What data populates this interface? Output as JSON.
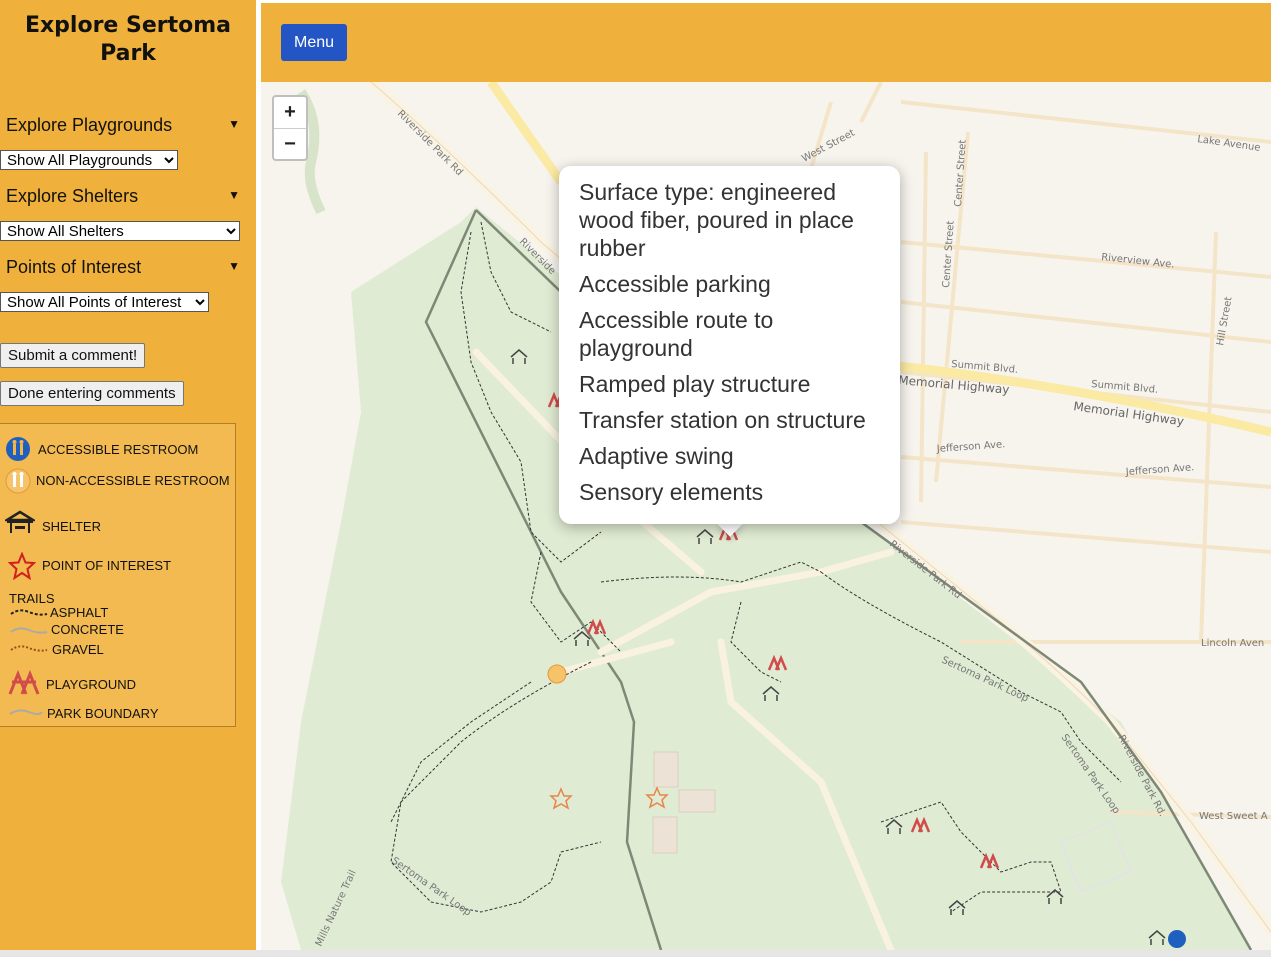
{
  "sidebar": {
    "title": "Explore Sertoma Park",
    "sections": [
      {
        "heading": "Explore Playgrounds",
        "select": "Show All Playgrounds"
      },
      {
        "heading": "Explore Shelters",
        "select": "Show All Shelters"
      },
      {
        "heading": "Points of Interest",
        "select": "Show All Points of Interest"
      }
    ],
    "submit_label": "Submit a comment!",
    "done_label": "Done entering comments"
  },
  "legend": {
    "accessible_restroom": "ACCESSIBLE RESTROOM",
    "nonaccessible_restroom": "NON-ACCESSIBLE RESTROOM",
    "shelter": "SHELTER",
    "point_of_interest": "POINT OF INTEREST",
    "trails": "TRAILS",
    "asphalt": "ASPHALT",
    "concrete": "CONCRETE",
    "gravel": "GRAVEL",
    "playground": "PLAYGROUND",
    "park_boundary": "PARK BOUNDARY"
  },
  "topbar": {
    "menu_label": "Menu"
  },
  "map": {
    "zoom_in": "+",
    "zoom_out": "−",
    "streets": {
      "riverside_park_rd_1": "Riverside Park Rd",
      "riverside_park_rd_2": "Riverside",
      "riverside_park_rd_3": "Riverside Park Rd",
      "riverside_park_rd_4": "Riverside Park Rd.",
      "west_street": "West Street",
      "lake_avenue": "Lake Avenue",
      "center_street_1": "Center Street",
      "center_street_2": "Center Street",
      "riverview_ave": "Riverview Ave.",
      "hill_street": "Hill Street",
      "summit_blvd_1": "Summit Blvd.",
      "summit_blvd_2": "Summit Blvd.",
      "memorial_highway_1": "Memorial Highway",
      "memorial_highway_2": "Memorial Highway",
      "jefferson_ave_1": "Jefferson Ave.",
      "jefferson_ave_2": "Jefferson Ave.",
      "lincoln_avenue": "Lincoln Aven",
      "west_sweet": "West Sweet A",
      "sertoma_park_loop_1": "Sertoma Park Loop",
      "sertoma_park_loop_2": "Sertoma Park Loop",
      "sertoma_park_loop_3": "Sertoma Park Loop",
      "mills_nature_trail": "Mills Nature Trail"
    },
    "popup": {
      "items": [
        "Surface type: engineered wood fiber, poured in place rubber",
        "Accessible parking",
        "Accessible route to playground",
        "Ramped play structure",
        "Transfer station on structure",
        "Adaptive swing",
        "Sensory elements"
      ]
    }
  },
  "colors": {
    "sidebar_bg": "#f0b13c",
    "menu_button": "#2356c4",
    "park_green": "#e0ebd3",
    "playground_icon": "#d24b4b",
    "poi_star": "#e8854a",
    "restroom_blue": "#1f5fbf"
  }
}
